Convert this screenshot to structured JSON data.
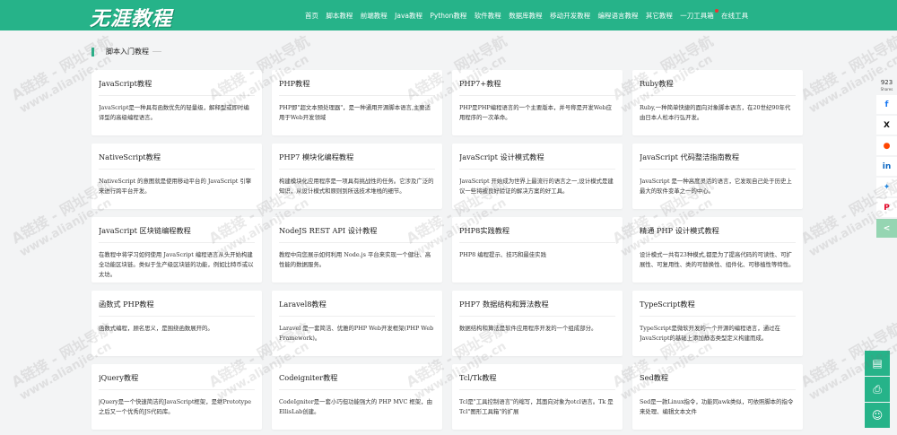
{
  "header": {
    "logo": "无涯教程",
    "nav": [
      {
        "name": "nav-home",
        "label": "首页"
      },
      {
        "name": "nav-script",
        "label": "脚本教程"
      },
      {
        "name": "nav-frontend",
        "label": "前端教程"
      },
      {
        "name": "nav-java",
        "label": "Java教程"
      },
      {
        "name": "nav-python",
        "label": "Python教程"
      },
      {
        "name": "nav-software",
        "label": "软件教程"
      },
      {
        "name": "nav-database",
        "label": "数据库教程"
      },
      {
        "name": "nav-mobile",
        "label": "移动开发教程"
      },
      {
        "name": "nav-programming",
        "label": "编程语言教程"
      },
      {
        "name": "nav-other",
        "label": "其它教程"
      },
      {
        "name": "nav-tools",
        "label": "一刀工具箱",
        "dot": true
      },
      {
        "name": "nav-online-tools",
        "label": "在线工具"
      }
    ]
  },
  "section": {
    "title": "脚本入门教程"
  },
  "cards": [
    {
      "title": "JavaScript教程",
      "desc": "JavaScript是一种具有函数优先的轻量级，解释型或即时编译型的高级编程语言。"
    },
    {
      "title": "PHP教程",
      "desc": "PHP即\"超文本预处理器\"，是一种通用开源脚本语言,主要适用于Web开发领域"
    },
    {
      "title": "PHP7+教程",
      "desc": "PHP是PHP编程语言的一个主要版本，并号称是开发Web应用程序的一次革命。"
    },
    {
      "title": "Ruby教程",
      "desc": "Ruby,一种简单快捷的面向对象脚本语言，在20世纪90年代由日本人松本行弘开发。"
    },
    {
      "title": "NativeScript教程",
      "desc": "NativeScript 的意图就是使用移动平台的 JavaScript 引擎来进行跨平台开发。"
    },
    {
      "title": "PHP7 模块化编程教程",
      "desc": "构建模块化应用程序是一项具有挑战性的任务。它涉及广泛的知识，从设计模式和原则到所选技术堆栈的细节。"
    },
    {
      "title": "JavaScript 设计模式教程",
      "desc": "JavaScript 开始成为世界上最流行的语言之一,设计模式是建议一些将被良好验证的解决方案的好工具。"
    },
    {
      "title": "JavaScript 代码整洁指南教程",
      "desc": "JavaScript 是一种高度灵活的语言，它发现自己处于历史上最大的软件变革之一的中心。"
    },
    {
      "title": "JavaScript 区块链编程教程",
      "desc": "在教程中将学习如何使用 JavaScript 编程语言从头开始构建全功能区块链。类似于生产级区块链的功能，例如比特币或以太坊。"
    },
    {
      "title": "NodeJS REST API 设计教程",
      "desc": "教程中向您展示如何利用 Node.js 平台来实现一个健壮、高性能的数据服务。"
    },
    {
      "title": "PHP8实践教程",
      "desc": "PHP8 编程提示、技巧和最佳实践"
    },
    {
      "title": "精通 PHP 设计模式教程",
      "desc": "设计模式一共有23种模式,都是为了提高代码的可读性、可扩展性、可复用性、类的可替换性、组件化、可移植性等特性。"
    },
    {
      "title": "函数式 PHP教程",
      "desc": "函数式编程，顾名思义，是围绕函数展开的。"
    },
    {
      "title": "Laravel8教程",
      "desc": "Laravel 是一套简洁、优雅的PHP Web开发框架(PHP Web Framework)。"
    },
    {
      "title": "PHP7 数据结构和算法教程",
      "desc": "数据结构和算法是软件应用程序开发的一个组成部分。"
    },
    {
      "title": "TypeScript教程",
      "desc": "TypeScript是微软开发的一个开源的编程语言，通过在JavaScript的基础上添加静态类型定义构建而成。"
    },
    {
      "title": "jQuery教程",
      "desc": "jQuery是一个快速简洁的JavaScript框架，是继Prototype之后又一个优秀的JS代码库。"
    },
    {
      "title": "Codeigniter教程",
      "desc": "CodeIgniter是一套小巧但功能强大的 PHP MVC 框架，由EllisLab创建。"
    },
    {
      "title": "Tcl/Tk教程",
      "desc": "Tcl是\"工具控制语言\"的缩写，其面向对象为otcl语言。Tk 是 Tcl\"图形工具箱\"的扩展"
    },
    {
      "title": "Sed教程",
      "desc": "Sed是一款Linux指令，功能同awk类似，可依照脚本的指令来处理、编辑文本文件"
    }
  ],
  "share": {
    "count": "923",
    "count_label": "Shares",
    "buttons": [
      {
        "name": "facebook-icon",
        "glyph": "f",
        "color": "#1877f2"
      },
      {
        "name": "x-twitter-icon",
        "glyph": "X",
        "color": "#111111"
      },
      {
        "name": "reddit-icon",
        "glyph": "●",
        "color": "#ff4500"
      },
      {
        "name": "linkedin-icon",
        "glyph": "in",
        "color": "#0a66c2"
      },
      {
        "name": "messenger-icon",
        "glyph": "✦",
        "color": "#1e88e5"
      },
      {
        "name": "pinterest-icon",
        "glyph": "P",
        "color": "#e60023"
      },
      {
        "name": "share-more-icon",
        "glyph": "<",
        "color": "#ffffff"
      }
    ]
  },
  "watermark": {
    "line1": "A链接 - 网址导航",
    "line2": "www.alianjie.cn"
  }
}
